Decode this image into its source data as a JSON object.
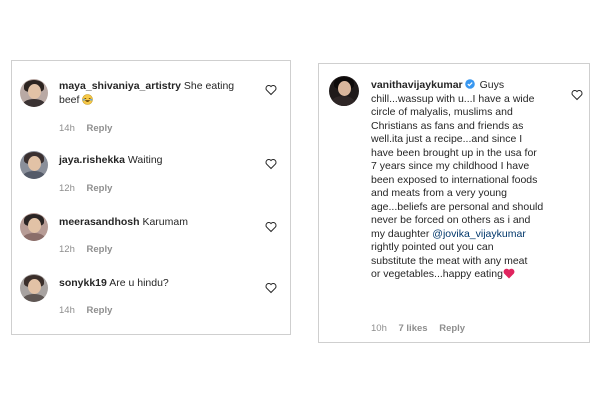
{
  "left_comments": [
    {
      "username": "maya_shivaniya_artistry",
      "text": "She eating beef",
      "time": "14h",
      "reply": "Reply"
    },
    {
      "username": "jaya.rishekka",
      "text": "Waiting",
      "time": "12h",
      "reply": "Reply"
    },
    {
      "username": "meerasandhosh",
      "text": "Karumam",
      "time": "12h",
      "reply": "Reply"
    },
    {
      "username": "sonykk19",
      "text": "Are u hindu?",
      "time": "14h",
      "reply": "Reply"
    }
  ],
  "right_comment": {
    "username": "vanithavijaykumar",
    "lines": [
      "chill...wassup with u...I have a wide",
      "circle of malyalis, muslims and",
      "Christians as fans and friends as",
      "well.ita just a recipe...and since I",
      "have been brought up in the usa for",
      "7 years since my childhood I have",
      "been exposed to international foods",
      "and meats from a very young",
      "age...beliefs are personal and should",
      "never be forced on others as i and",
      "my daughter",
      "rightly pointed out you can",
      "substitute the meat with any meat",
      "or vegetables...happy eating"
    ],
    "first_word": "Guys",
    "mention": "@jovika_vijaykumar",
    "time": "10h",
    "likes": "7 likes",
    "reply": "Reply"
  },
  "icons": {
    "heart": "heart-outline-icon",
    "verified": "verified-badge-icon",
    "emoji_laugh": "laughing-emoji-icon",
    "emoji_heart": "red-heart-emoji-icon"
  },
  "colors": {
    "verified_blue": "#3897f0",
    "mention_blue": "#00376b",
    "meta_gray": "#8e8e8e",
    "heart_red": "#e0245e"
  }
}
